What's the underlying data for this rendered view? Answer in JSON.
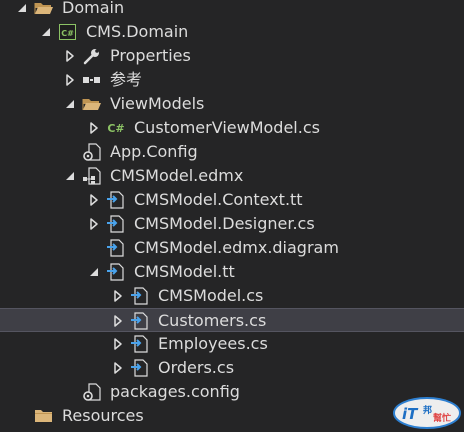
{
  "solution_explorer": {
    "items": [
      {
        "label": "Domain",
        "icon": "folder-open-icon",
        "arrow": "expanded",
        "selected": false
      },
      {
        "label": "CMS.Domain",
        "icon": "csharp-project-icon",
        "arrow": "expanded",
        "selected": false
      },
      {
        "label": "Properties",
        "icon": "wrench-icon",
        "arrow": "collapsed",
        "selected": false
      },
      {
        "label": "参考",
        "icon": "references-icon",
        "arrow": "collapsed",
        "selected": false
      },
      {
        "label": "ViewModels",
        "icon": "folder-open-icon",
        "arrow": "expanded",
        "selected": false
      },
      {
        "label": "CustomerViewModel.cs",
        "icon": "csharp-file-icon",
        "arrow": "collapsed",
        "selected": false
      },
      {
        "label": "App.Config",
        "icon": "config-file-icon",
        "arrow": "none",
        "selected": false
      },
      {
        "label": "CMSModel.edmx",
        "icon": "edmx-file-icon",
        "arrow": "expanded",
        "selected": false
      },
      {
        "label": "CMSModel.Context.tt",
        "icon": "generated-file-icon",
        "arrow": "collapsed",
        "selected": false
      },
      {
        "label": "CMSModel.Designer.cs",
        "icon": "generated-file-icon",
        "arrow": "collapsed",
        "selected": false
      },
      {
        "label": "CMSModel.edmx.diagram",
        "icon": "generated-file-icon",
        "arrow": "none",
        "selected": false
      },
      {
        "label": "CMSModel.tt",
        "icon": "generated-file-icon",
        "arrow": "expanded",
        "selected": false
      },
      {
        "label": "CMSModel.cs",
        "icon": "generated-file-icon",
        "arrow": "collapsed",
        "selected": false
      },
      {
        "label": "Customers.cs",
        "icon": "generated-file-icon",
        "arrow": "collapsed",
        "selected": true
      },
      {
        "label": "Employees.cs",
        "icon": "generated-file-icon",
        "arrow": "collapsed",
        "selected": false
      },
      {
        "label": "Orders.cs",
        "icon": "generated-file-icon",
        "arrow": "collapsed",
        "selected": false
      },
      {
        "label": "packages.config",
        "icon": "config-file-icon",
        "arrow": "none",
        "selected": false
      },
      {
        "label": "Resources",
        "icon": "folder-closed-icon",
        "arrow": "none",
        "selected": false
      }
    ]
  },
  "watermark": {
    "brand": "iT邦幫忙"
  },
  "colors": {
    "background": "#252526",
    "text": "#dcdcdc",
    "selected_row": "#3f3f46",
    "folder": "#dcb67a",
    "csharp": "#8cc265",
    "generated_file_arrow": "#4aa3ec"
  }
}
